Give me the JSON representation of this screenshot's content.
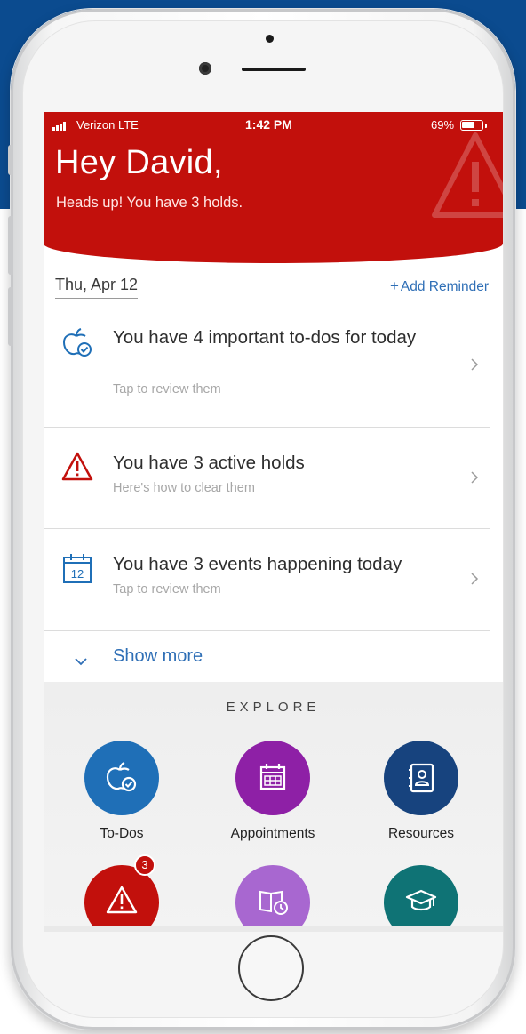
{
  "status_bar": {
    "carrier": "Verizon  LTE",
    "time": "1:42 PM",
    "battery": "69%",
    "battery_level": 0.69
  },
  "header": {
    "greeting": "Hey David,",
    "subtitle": "Heads up! You have 3 holds.",
    "background_color": "#c2100c"
  },
  "date_row": {
    "date": "Thu, Apr 12",
    "add_reminder_plus": "+",
    "add_reminder_label": "Add Reminder"
  },
  "cards": [
    {
      "title": "You have 4 important to-dos for today",
      "subtitle": "Tap to review them",
      "icon": "apple-check-icon"
    },
    {
      "title": "You have 3 active holds",
      "subtitle": "Here's how to clear them",
      "icon": "warning-icon"
    },
    {
      "title": "You have 3 events happening today",
      "subtitle": "Tap to review them",
      "icon": "calendar-icon",
      "icon_text": "12"
    }
  ],
  "show_more": "Show more",
  "explore": {
    "title": "EXPLORE",
    "tiles": [
      {
        "label": "To-Dos",
        "color": "#1f6fb7",
        "icon": "apple-check-icon"
      },
      {
        "label": "Appointments",
        "color": "#8e20a6",
        "icon": "calendar-icon"
      },
      {
        "label": "Resources",
        "color": "#17437e",
        "icon": "contacts-book-icon"
      },
      {
        "label": "",
        "color": "#c2100c",
        "icon": "warning-icon",
        "badge": "3"
      },
      {
        "label": "",
        "color": "#a867d0",
        "icon": "book-clock-icon"
      },
      {
        "label": "",
        "color": "#0f7375",
        "icon": "graduation-cap-icon"
      }
    ]
  },
  "colors": {
    "accent_blue": "#2f6fb6",
    "alert_red": "#c2100c",
    "brand_band": "#0b4b8f"
  }
}
